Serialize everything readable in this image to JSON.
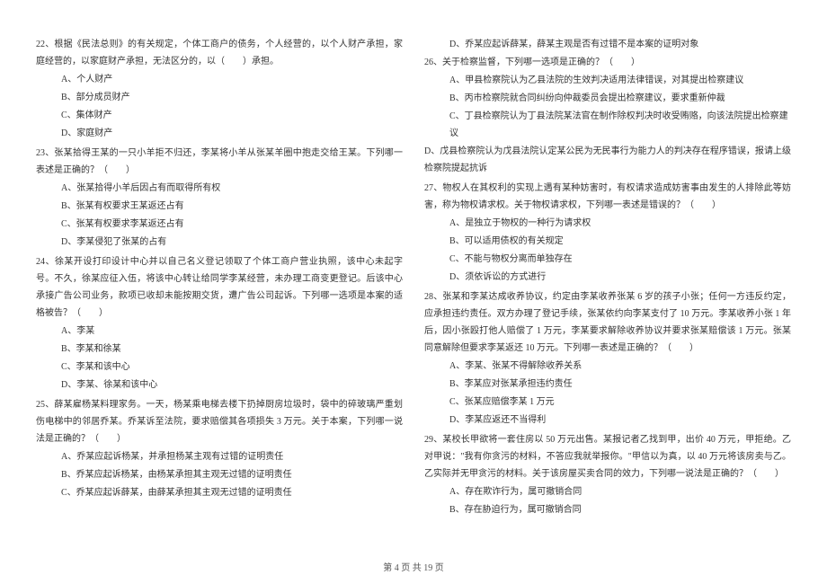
{
  "left": {
    "q22": {
      "text": "22、根据《民法总则》的有关规定，个体工商户的债务，个人经营的，以个人财产承担，家庭经营的，以家庭财产承担，无法区分的，以（　　）承担。",
      "options": {
        "A": "A、个人财产",
        "B": "B、部分成员财产",
        "C": "C、集体财产",
        "D": "D、家庭财产"
      }
    },
    "q23": {
      "text": "23、张某拾得王某的一只小羊拒不归还，李某将小羊从张某羊圈中抱走交给王某。下列哪一表述是正确的？（　　）",
      "options": {
        "A": "A、张某拾得小羊后因占有而取得所有权",
        "B": "B、张某有权要求王某返还占有",
        "C": "C、张某有权要求李某返还占有",
        "D": "D、李某侵犯了张某的占有"
      }
    },
    "q24": {
      "text": "24、徐某开设打印设计中心并以自己名义登记领取了个体工商户营业执照，该中心未起字号。不久，徐某应征入伍，将该中心转让给同学李某经营，未办理工商变更登记。后该中心承接广告公司业务，款项已收却未能按期交货，遭广告公司起诉。下列哪一选项是本案的适格被告？（　　）",
      "options": {
        "A": "A、李某",
        "B": "B、李某和徐某",
        "C": "C、李某和该中心",
        "D": "D、李某、徐某和该中心"
      }
    },
    "q25": {
      "text": "25、薛某雇杨某料理家务。一天，杨某乘电梯去楼下扔掉厨房垃圾时，袋中的碎玻璃严重划伤电梯中的邻居乔某。乔某诉至法院，要求赔偿其各项损失 3 万元。关于本案，下列哪一说法是正确的？（　　）",
      "options": {
        "A": "A、乔某应起诉杨某，并承担杨某主观有过错的证明责任",
        "B": "B、乔某应起诉杨某，由杨某承担其主观无过错的证明责任",
        "C": "C、乔某应起诉薛某，由薛某承担其主观无过错的证明责任"
      }
    }
  },
  "right": {
    "q25d": "D、乔某应起诉薛某，薛某主观是否有过错不是本案的证明对象",
    "q26": {
      "text": "26、关于检察监督，下列哪一选项是正确的？（　　）",
      "options": {
        "A": "A、甲县检察院认为乙县法院的生效判决适用法律错误，对其提出检察建议",
        "B": "B、丙市检察院就合同纠纷向仲裁委员会提出检察建议，要求重新仲裁",
        "C": "C、丁县检察院认为丁县法院某法官在制作除权判决时收受贿赂，向该法院提出检察建议",
        "D": "D、戊县检察院认为戊县法院认定某公民为无民事行为能力人的判决存在程序错误，报请上级检察院提起抗诉"
      }
    },
    "q27": {
      "text": "27、物权人在其权利的实现上遇有某种妨害时，有权请求造成妨害事由发生的人排除此等妨害，称为物权请求权。关于物权请求权，下列哪一表述是错误的？（　　）",
      "options": {
        "A": "A、是独立于物权的一种行为请求权",
        "B": "B、可以适用债权的有关规定",
        "C": "C、不能与物权分离而单独存在",
        "D": "D、须依诉讼的方式进行"
      }
    },
    "q28": {
      "text": "28、张某和李某达成收养协议，约定由李某收养张某 6 岁的孩子小张；任何一方违反约定，应承担违约责任。双方办理了登记手续，张某依约向李某支付了 10 万元。李某收养小张 1 年后，因小张殴打他人赔偿了 1 万元，李某要求解除收养协议并要求张某赔偿该 1 万元。张某同意解除但要求李某返还 10 万元。下列哪一表述是正确的？（　　）",
      "options": {
        "A": "A、李某、张某不得解除收养关系",
        "B": "B、李某应对张某承担违约责任",
        "C": "C、张某应赔偿李某 1 万元",
        "D": "D、李某应返还不当得利"
      }
    },
    "q29": {
      "text": "29、某校长甲欲将一套住房以 50 万元出售。某报记者乙找到甲，出价 40 万元，甲拒绝。乙对甲说：\"我有你贪污的材料，不答应我就举报你。\"甲信以为真，以 40 万元将该房卖与乙。乙实际并无甲贪污的材料。关于该房屋买卖合同的效力，下列哪一说法是正确的？（　　）",
      "options": {
        "A": "A、存在欺诈行为，属可撤销合同",
        "B": "B、存在胁迫行为，属可撤销合同"
      }
    }
  },
  "footer": "第 4 页 共 19 页"
}
